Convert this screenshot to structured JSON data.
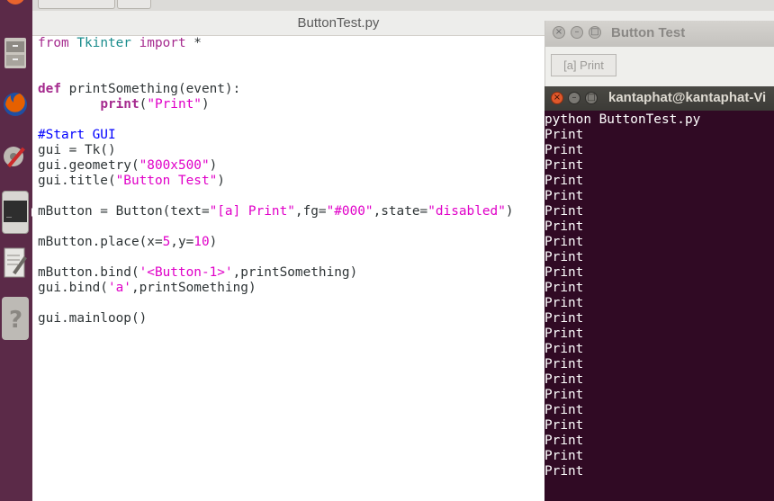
{
  "launcher": {
    "items": [
      {
        "name": "dash-home-icon",
        "color": "#e9632d"
      },
      {
        "name": "files-icon",
        "color": "#c9c5be"
      },
      {
        "name": "firefox-icon",
        "color": "#e66000"
      },
      {
        "name": "settings-icon",
        "color": "#c33"
      },
      {
        "name": "terminal-icon",
        "color": "#2e2e2e"
      },
      {
        "name": "text-editor-icon",
        "color": "#e7e6e3"
      },
      {
        "name": "help-icon",
        "color": "#9a9792"
      }
    ],
    "accent": "#5b2a48"
  },
  "editor": {
    "tab_title": "ButtonTest.py",
    "code_lines": [
      [
        [
          "kw2",
          "from "
        ],
        [
          "cls",
          "Tkinter"
        ],
        [
          "kw2",
          " import "
        ],
        [
          "",
          "*"
        ]
      ],
      [],
      [],
      [
        [
          "kw",
          "def "
        ],
        [
          "",
          "printSomething(event):"
        ]
      ],
      [
        [
          "",
          "        "
        ],
        [
          "kw",
          "print"
        ],
        [
          "",
          "("
        ],
        [
          "str",
          "\"Print\""
        ],
        [
          "",
          ")"
        ]
      ],
      [],
      [
        [
          "cmt",
          "#Start GUI"
        ]
      ],
      [
        [
          "",
          "gui = Tk()"
        ]
      ],
      [
        [
          "",
          "gui.geometry("
        ],
        [
          "str",
          "\"800x500\""
        ],
        [
          "",
          ")"
        ]
      ],
      [
        [
          "",
          "gui.title("
        ],
        [
          "str",
          "\"Button Test\""
        ],
        [
          "",
          ")"
        ]
      ],
      [],
      [
        [
          "",
          "mButton = Button(text="
        ],
        [
          "str",
          "\"[a] Print\""
        ],
        [
          "",
          ",fg="
        ],
        [
          "str",
          "\"#000\""
        ],
        [
          "",
          ",state="
        ],
        [
          "str",
          "\"disabled\""
        ],
        [
          "",
          ")"
        ]
      ],
      [],
      [
        [
          "",
          "mButton.place(x="
        ],
        [
          "num",
          "5"
        ],
        [
          "",
          ",y="
        ],
        [
          "num",
          "10"
        ],
        [
          "",
          ")"
        ]
      ],
      [],
      [
        [
          "",
          "mButton.bind("
        ],
        [
          "str",
          "'<Button-1>'"
        ],
        [
          "",
          ",printSomething)"
        ]
      ],
      [
        [
          "",
          "gui.bind("
        ],
        [
          "str",
          "'a'"
        ],
        [
          "",
          ",printSomething)"
        ]
      ],
      [],
      [
        [
          "",
          "gui.mainloop()"
        ]
      ]
    ]
  },
  "tk_window": {
    "title": "Button Test",
    "button_label": "[a] Print",
    "close_glyph": "×",
    "min_glyph": "–",
    "max_glyph": "□"
  },
  "terminal": {
    "title": "kantaphat@kantaphat-Vi",
    "close_glyph": "×",
    "min_glyph": "–",
    "max_glyph": "□",
    "lines": [
      "python ButtonTest.py",
      "Print",
      "Print",
      "Print",
      "Print",
      "Print",
      "Print",
      "Print",
      "Print",
      "Print",
      "Print",
      "Print",
      "Print",
      "Print",
      "Print",
      "Print",
      "Print",
      "Print",
      "Print",
      "Print",
      "Print",
      "Print",
      "Print",
      "Print"
    ],
    "background": "#300a24"
  }
}
